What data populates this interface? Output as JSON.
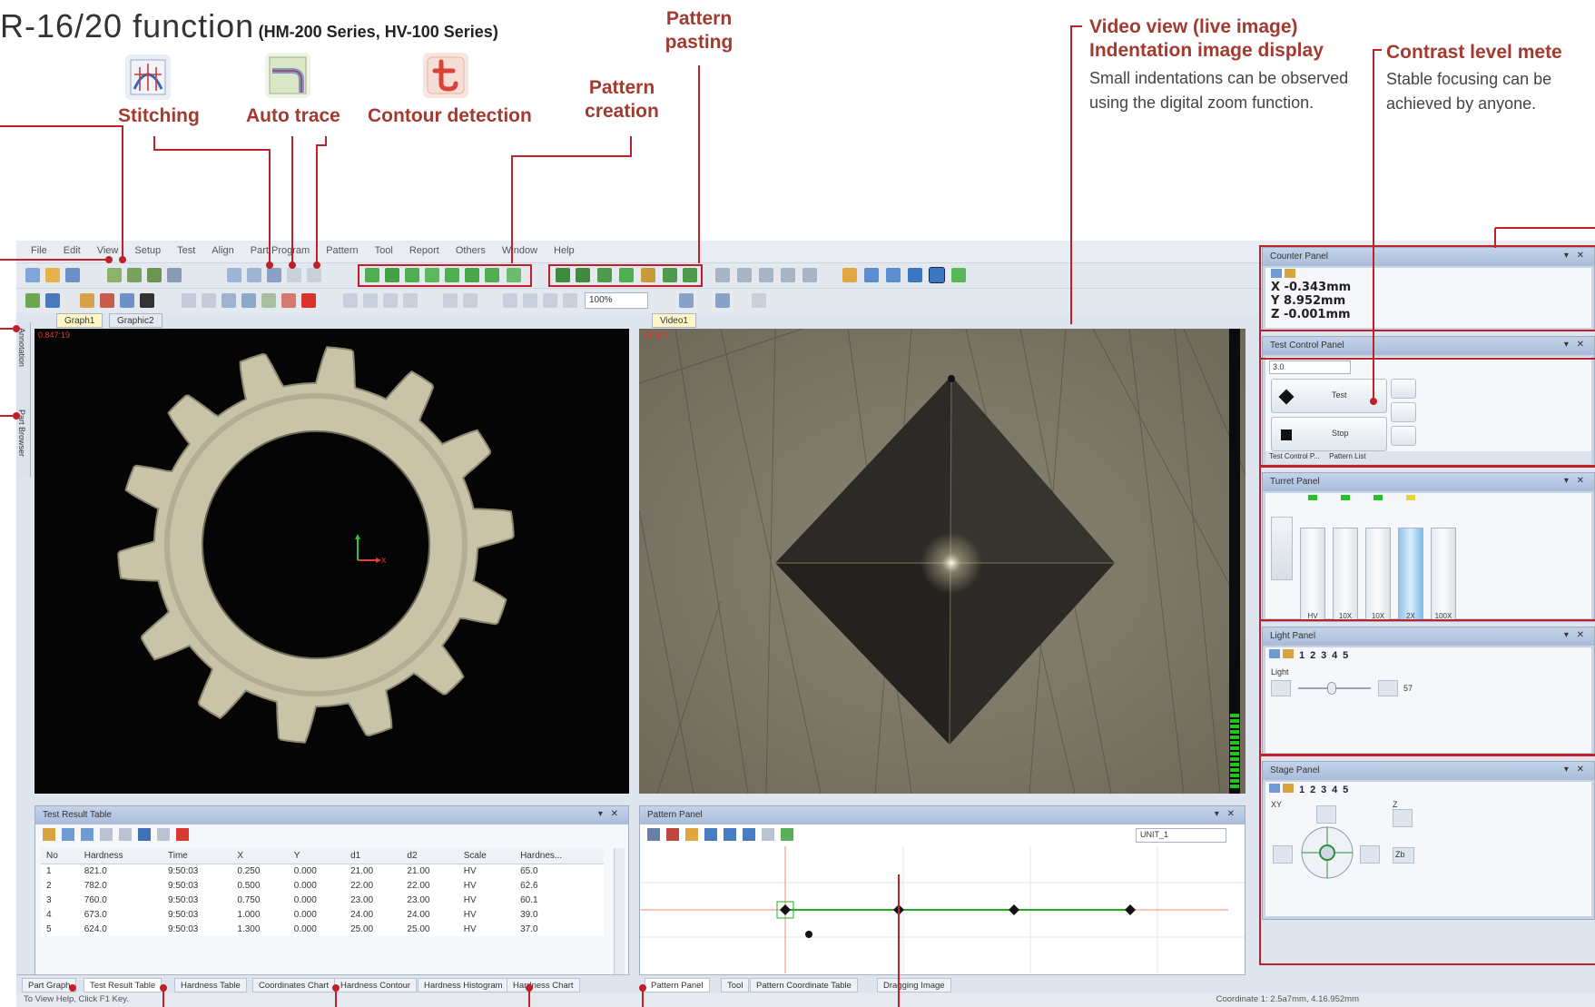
{
  "heading": {
    "title": "R-16/20 function",
    "subtitle_open": "(",
    "subtitle_a": "HM-200 Series",
    "subtitle_sep": ", ",
    "subtitle_b": "HV-100 Series",
    "subtitle_close": ")"
  },
  "callouts": {
    "stitching": "Stitching",
    "auto_trace": "Auto trace",
    "contour_detection": "Contour detection",
    "pattern_creation_1": "Pattern",
    "pattern_creation_2": "creation",
    "pattern_pasting_1": "Pattern",
    "pattern_pasting_2": "pasting",
    "video_view_1": "Video view (live image)",
    "video_view_2": "Indentation image display",
    "video_view_desc": "Small indentations can be observed using the digital zoom function.",
    "contrast_meter": "Contrast level mete",
    "contrast_meter_desc": "Stable focusing can be achieved by anyone."
  },
  "app": {
    "menu": [
      "File",
      "Edit",
      "View",
      "Setup",
      "Test",
      "Align",
      "Part Program",
      "Pattern",
      "Tool",
      "Report",
      "Others",
      "Window",
      "Help"
    ],
    "zoom_value": "100%",
    "graphic_tabs": [
      "Graph1",
      "Graphic2"
    ],
    "side_tabs": [
      "Annotation",
      "Part Browser"
    ],
    "graphic_readout": "0.847:19",
    "axis_x_label": "X",
    "video_tab": "Video1",
    "video_readout": "1.8000",
    "result_panel_title": "Test Result Table",
    "result_columns": [
      "No",
      "Hardness",
      "Time",
      "X",
      "Y",
      "d1",
      "d2",
      "Scale",
      "Hardnes..."
    ],
    "result_rows": [
      [
        "1",
        "821.0",
        "9:50:03",
        "0.250",
        "0.000",
        "21.00",
        "21.00",
        "HV",
        "65.0"
      ],
      [
        "2",
        "782.0",
        "9:50:03",
        "0.500",
        "0.000",
        "22.00",
        "22.00",
        "HV",
        "62.6"
      ],
      [
        "3",
        "760.0",
        "9:50:03",
        "0.750",
        "0.000",
        "23.00",
        "23.00",
        "HV",
        "60.1"
      ],
      [
        "4",
        "673.0",
        "9:50:03",
        "1.000",
        "0.000",
        "24.00",
        "24.00",
        "HV",
        "39.0"
      ],
      [
        "5",
        "624.0",
        "9:50:03",
        "1.300",
        "0.000",
        "25.00",
        "25.00",
        "HV",
        "37.0"
      ]
    ],
    "result_bottom_tabs": [
      "Part Graph",
      "Test Result Table",
      "Hardness Table",
      "Coordinates Chart",
      "Hardness Contour",
      "Hardness Histogram",
      "Hardness Chart"
    ],
    "pattern_panel_title": "Pattern Panel",
    "pattern_unit": "UNIT_1",
    "pattern_bottom_tabs": [
      "Pattern Panel",
      "Tool",
      "Pattern Coordinate Table",
      "Dragging Image"
    ],
    "counter": {
      "title": "Counter Panel",
      "x": "X  -0.343mm",
      "y": "Y   8.952mm",
      "z": "Z  -0.001mm"
    },
    "test_control": {
      "title": "Test Control Panel",
      "field": "3.0",
      "test": "Test",
      "stop": "Stop",
      "tab_a": "Test Control P...",
      "tab_b": "Pattern List"
    },
    "turret": {
      "title": "Turret Panel",
      "labels": [
        "HV",
        "10X",
        "10X",
        "2X",
        "100X"
      ]
    },
    "light": {
      "title": "Light Panel",
      "numbers": [
        "1",
        "2",
        "3",
        "4",
        "5"
      ],
      "label": "Light",
      "value": "57"
    },
    "stage": {
      "title": "Stage Panel",
      "numbers": [
        "1",
        "2",
        "3",
        "4",
        "5"
      ],
      "xy": "XY",
      "z": "Z",
      "zb": "Zb"
    },
    "status_left": "To View Help, Click F1 Key.",
    "status_right": "Coordinate 1: 2.5a7mm, 4.16.952mm"
  },
  "colors": {
    "accent_red": "#a33a2f",
    "contrast_green": "#22c51f",
    "pattern_line": "#22b022"
  }
}
